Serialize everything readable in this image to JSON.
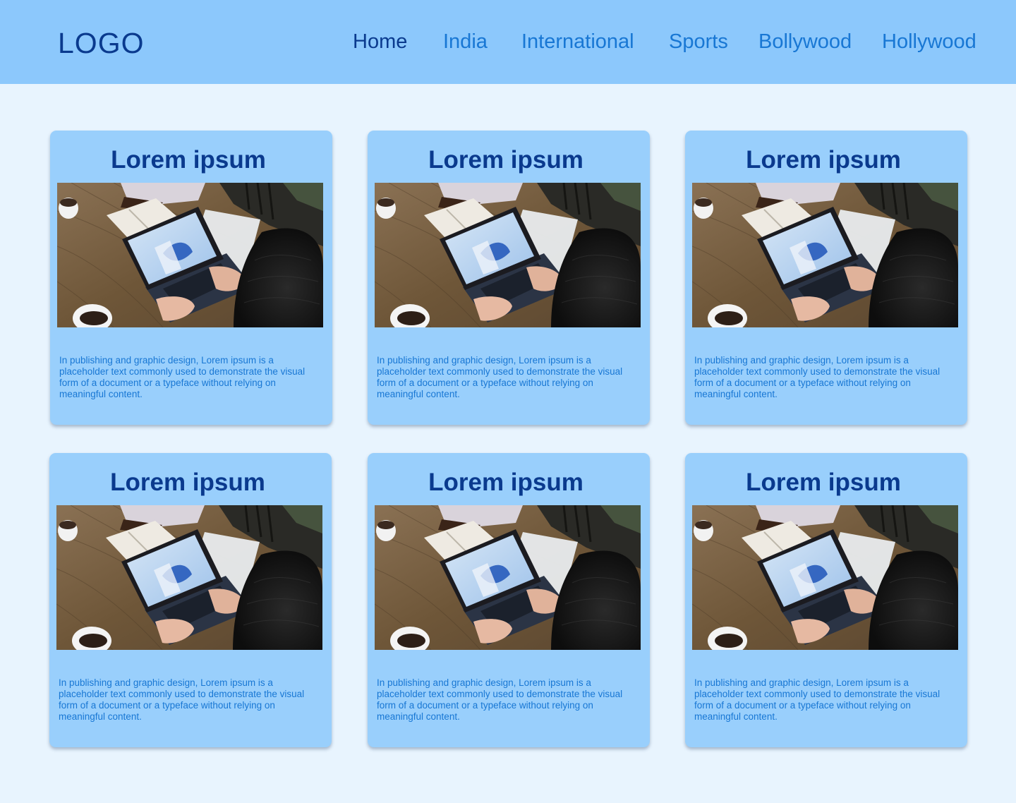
{
  "header": {
    "logo": "LOGO",
    "nav": [
      {
        "label": "Home",
        "active": true
      },
      {
        "label": "India",
        "active": false
      },
      {
        "label": "International",
        "active": false
      },
      {
        "label": "Sports",
        "active": false
      },
      {
        "label": "Bollywood",
        "active": false
      },
      {
        "label": "Hollywood",
        "active": false
      }
    ]
  },
  "cards": [
    {
      "title": "Lorem ipsum",
      "text": "In publishing and graphic design, Lorem ipsum is a placeholder text commonly used to demonstrate the visual form of a document or a typeface without relying on meaningful content."
    },
    {
      "title": "Lorem ipsum",
      "text": "In publishing and graphic design, Lorem ipsum is a placeholder text commonly used to demonstrate the visual form of a document or a typeface without relying on meaningful content."
    },
    {
      "title": "Lorem ipsum",
      "text": "In publishing and graphic design, Lorem ipsum is a placeholder text commonly used to demonstrate the visual form of a document or a typeface without relying on meaningful content."
    },
    {
      "title": "Lorem ipsum",
      "text": "In publishing and graphic design, Lorem ipsum is a placeholder text commonly used to demonstrate the visual form of a document or a typeface without relying on meaningful content."
    },
    {
      "title": "Lorem ipsum",
      "text": "In publishing and graphic design, Lorem ipsum is a placeholder text commonly used to demonstrate the visual form of a document or a typeface without relying on meaningful content."
    },
    {
      "title": "Lorem ipsum",
      "text": "In publishing and graphic design, Lorem ipsum is a placeholder text commonly used to demonstrate the visual form of a document or a typeface without relying on meaningful content."
    }
  ],
  "colors": {
    "header_bg": "#8cc8fc",
    "page_bg": "#e8f4fe",
    "card_bg": "#99cffc",
    "dark_blue": "#0a3a8e",
    "accent_blue": "#1877d4"
  }
}
